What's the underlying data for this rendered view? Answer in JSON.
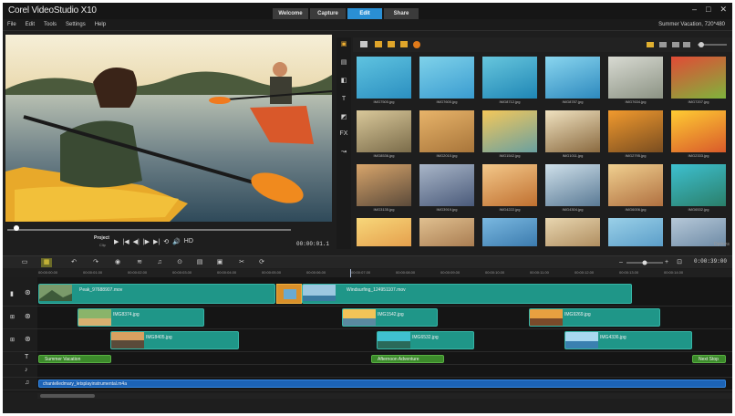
{
  "app": {
    "brand": "Corel VideoStudio X10",
    "window_controls": [
      "–",
      "□",
      "✕"
    ]
  },
  "tabs": [
    {
      "label": "Welcome"
    },
    {
      "label": "Capture"
    },
    {
      "label": "Edit",
      "active": true
    },
    {
      "label": "Share"
    }
  ],
  "menu": [
    "File",
    "Edit",
    "Tools",
    "Settings",
    "Help"
  ],
  "project_info": "Summer Vacation, 720*480",
  "player": {
    "mode": "Project",
    "sub": "Clip",
    "controls": [
      "▶",
      "|◀",
      "◀|",
      "|▶",
      "▶|",
      "⟲",
      "🔊",
      "HD"
    ],
    "timecode": "00:00:01.1"
  },
  "library": {
    "thumbs": [
      {
        "label": "IMG7500.jpg",
        "colors": [
          "#5fc3e0",
          "#2b8fc0"
        ]
      },
      {
        "label": "IMG7600.jpg",
        "colors": [
          "#7fd2ea",
          "#3a9cd0"
        ]
      },
      {
        "label": "IMG8712.jpg",
        "colors": [
          "#67c6dd",
          "#1f86b5"
        ]
      },
      {
        "label": "IMG8787.jpg",
        "colors": [
          "#8ad6ef",
          "#2d89be"
        ]
      },
      {
        "label": "IMG7634.jpg",
        "colors": [
          "#d8dad2",
          "#8c9384"
        ]
      },
      {
        "label": "IMG7207.jpg",
        "colors": [
          "#e24a36",
          "#7fb43c"
        ]
      },
      {
        "label": "IMG8536.jpg",
        "colors": [
          "#d9c89a",
          "#7b6c4a"
        ]
      },
      {
        "label": "IMG2010.jpg",
        "colors": [
          "#e8b46a",
          "#a8753a"
        ]
      },
      {
        "label": "IMG1542.jpg",
        "colors": [
          "#f4c85a",
          "#6aa0a0"
        ]
      },
      {
        "label": "IMG1011.jpg",
        "colors": [
          "#f0e2c0",
          "#8a6a40"
        ]
      },
      {
        "label": "IMG2795.jpg",
        "colors": [
          "#f19a2e",
          "#7a4d20"
        ]
      },
      {
        "label": "IMG2333.jpg",
        "colors": [
          "#ffcc33",
          "#d95a2a"
        ]
      },
      {
        "label": "IMG3135.jpg",
        "colors": [
          "#d8a56b",
          "#5b4a3a"
        ]
      },
      {
        "label": "IMG3919.jpg",
        "colors": [
          "#a9b6c8",
          "#4a5a7a"
        ]
      },
      {
        "label": "IMG4222.jpg",
        "colors": [
          "#f3c88a",
          "#c07030"
        ]
      },
      {
        "label": "IMG4304.jpg",
        "colors": [
          "#cfe0ea",
          "#5a7a95"
        ]
      },
      {
        "label": "IMG6006.jpg",
        "colors": [
          "#f0d090",
          "#b07040"
        ]
      },
      {
        "label": "IMG6532.jpg",
        "colors": [
          "#3ec0d0",
          "#2a7f6a"
        ]
      },
      {
        "label": "",
        "colors": [
          "#f7d77a",
          "#e09040"
        ]
      },
      {
        "label": "",
        "colors": [
          "#e0c090",
          "#9a6a40"
        ]
      },
      {
        "label": "",
        "colors": [
          "#7ab8e0",
          "#2a6aa0"
        ]
      },
      {
        "label": "",
        "colors": [
          "#e8d6b0",
          "#a07a4a"
        ]
      },
      {
        "label": "",
        "colors": [
          "#9ad0e8",
          "#4a90c0"
        ]
      },
      {
        "label": "",
        "colors": [
          "#b6c8d8",
          "#5a7a98"
        ]
      }
    ],
    "options_label": "Options"
  },
  "timeline": {
    "timecode": "0:00:39:00",
    "ruler": [
      "00:00:00.00",
      "00:00:01.00",
      "00:00:02.00",
      "00:00:03.00",
      "00:00:04.00",
      "00:00:05.00",
      "00:00:06.00",
      "00:00:07.00",
      "00:00:08.00",
      "00:00:09.00",
      "00:00:10.00",
      "00:00:11.00",
      "00:00:12.00",
      "00:00:13.00",
      "00:00:14.00"
    ],
    "video_clips": [
      {
        "label": "Peak_97688907.mov"
      },
      {
        "label": "Windsurfing_124951107.mov"
      }
    ],
    "overlay1": [
      {
        "label": "IMG8374.jpg"
      },
      {
        "label": "IMG1542.jpg"
      },
      {
        "label": "IMG9269.jpg"
      }
    ],
    "overlay2": [
      {
        "label": "IMG8405.jpg"
      },
      {
        "label": "IMG6532.jpg"
      },
      {
        "label": "IMG4336.jpg"
      }
    ],
    "titles": [
      {
        "label": "Summer Vacation"
      },
      {
        "label": "Afternoon Adventure"
      },
      {
        "label": "Next Stop"
      }
    ],
    "audio": [
      {
        "label": "chantelledmary_letsplayinstrumental.m4a"
      }
    ]
  }
}
